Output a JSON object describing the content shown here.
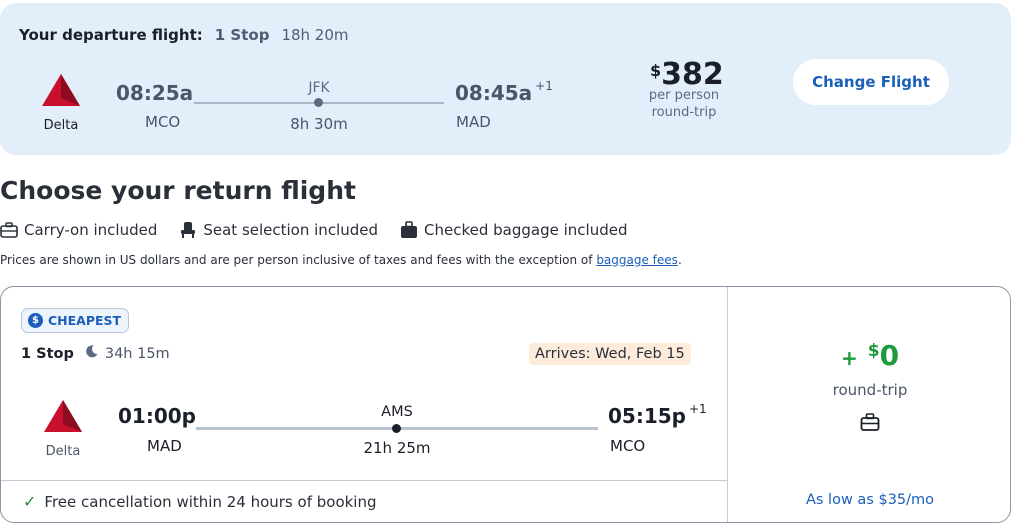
{
  "departure": {
    "header_title": "Your departure flight:",
    "stops": "1 Stop",
    "duration": "18h 20m",
    "airline": "Delta",
    "depart_time": "08:25a",
    "depart_code": "MCO",
    "layover_code": "JFK",
    "segment_duration": "8h 30m",
    "arrive_time": "08:45a",
    "arrive_day_offset": "+1",
    "arrive_code": "MAD",
    "price_currency": "$",
    "price_amount": "382",
    "price_sub1": "per person",
    "price_sub2": "round-trip",
    "change_button": "Change Flight"
  },
  "return_section": {
    "title": "Choose your return flight",
    "amenities": [
      "Carry-on included",
      "Seat selection included",
      "Checked baggage included"
    ],
    "note_text": "Prices are shown in US dollars and are per person inclusive of taxes and fees with the exception of ",
    "note_link": "baggage fees",
    "note_end": "."
  },
  "return_option": {
    "badge_icon": "$",
    "badge": "CHEAPEST",
    "stops": "1 Stop",
    "duration": "34h 15m",
    "arrives": "Arrives: Wed, Feb 15",
    "airline": "Delta",
    "depart_time": "01:00p",
    "depart_code": "MAD",
    "layover_code": "AMS",
    "segment_duration": "21h 25m",
    "arrive_time": "05:15p",
    "arrive_day_offset": "+1",
    "arrive_code": "MCO",
    "free_cancel": "Free cancellation within 24 hours of booking",
    "add_prefix": "+",
    "add_currency": "$",
    "add_amount": "0",
    "add_label": "round-trip",
    "financing": "As low as $35/mo"
  },
  "colors": {
    "accent_blue": "#1b5fbb",
    "price_green": "#1e9a3a",
    "delta_red": "#c8102e",
    "departure_bg": "#e3eefb"
  }
}
